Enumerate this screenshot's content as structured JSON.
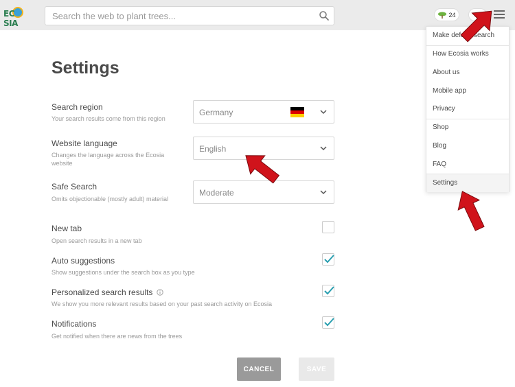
{
  "header": {
    "logo_text": "EC SIA",
    "search_placeholder": "Search the web to plant trees...",
    "tree_count": "24"
  },
  "page": {
    "title": "Settings"
  },
  "settings": {
    "region": {
      "label": "Search region",
      "desc": "Your search results come from this region",
      "value": "Germany"
    },
    "language": {
      "label": "Website language",
      "desc_line1": "Changes the language across the Ecosia",
      "desc_line2": "website",
      "value": "English"
    },
    "safe_search": {
      "label": "Safe Search",
      "desc": "Omits objectionable (mostly adult) material",
      "value": "Moderate"
    },
    "new_tab": {
      "label": "New tab",
      "desc": "Open search results in a new tab",
      "checked": false
    },
    "auto_suggestions": {
      "label": "Auto suggestions",
      "desc": "Show suggestions under the search box as you type",
      "checked": true
    },
    "personalized": {
      "label": "Personalized search results",
      "desc": "We show you more relevant results based on your past search activity on Ecosia",
      "checked": true
    },
    "notifications": {
      "label": "Notifications",
      "desc": "Get notified when there are news from the trees",
      "checked": true
    }
  },
  "buttons": {
    "cancel": "CANCEL",
    "save": "SAVE"
  },
  "menu": {
    "items": [
      "Make default search",
      "How Ecosia works",
      "About us",
      "Mobile app",
      "Privacy",
      "Shop",
      "Blog",
      "FAQ",
      "Settings"
    ]
  },
  "colors": {
    "accent_check": "#2a9fb0",
    "annotation_arrow": "#d0131b",
    "cancel_bg": "#9a9a9a"
  }
}
